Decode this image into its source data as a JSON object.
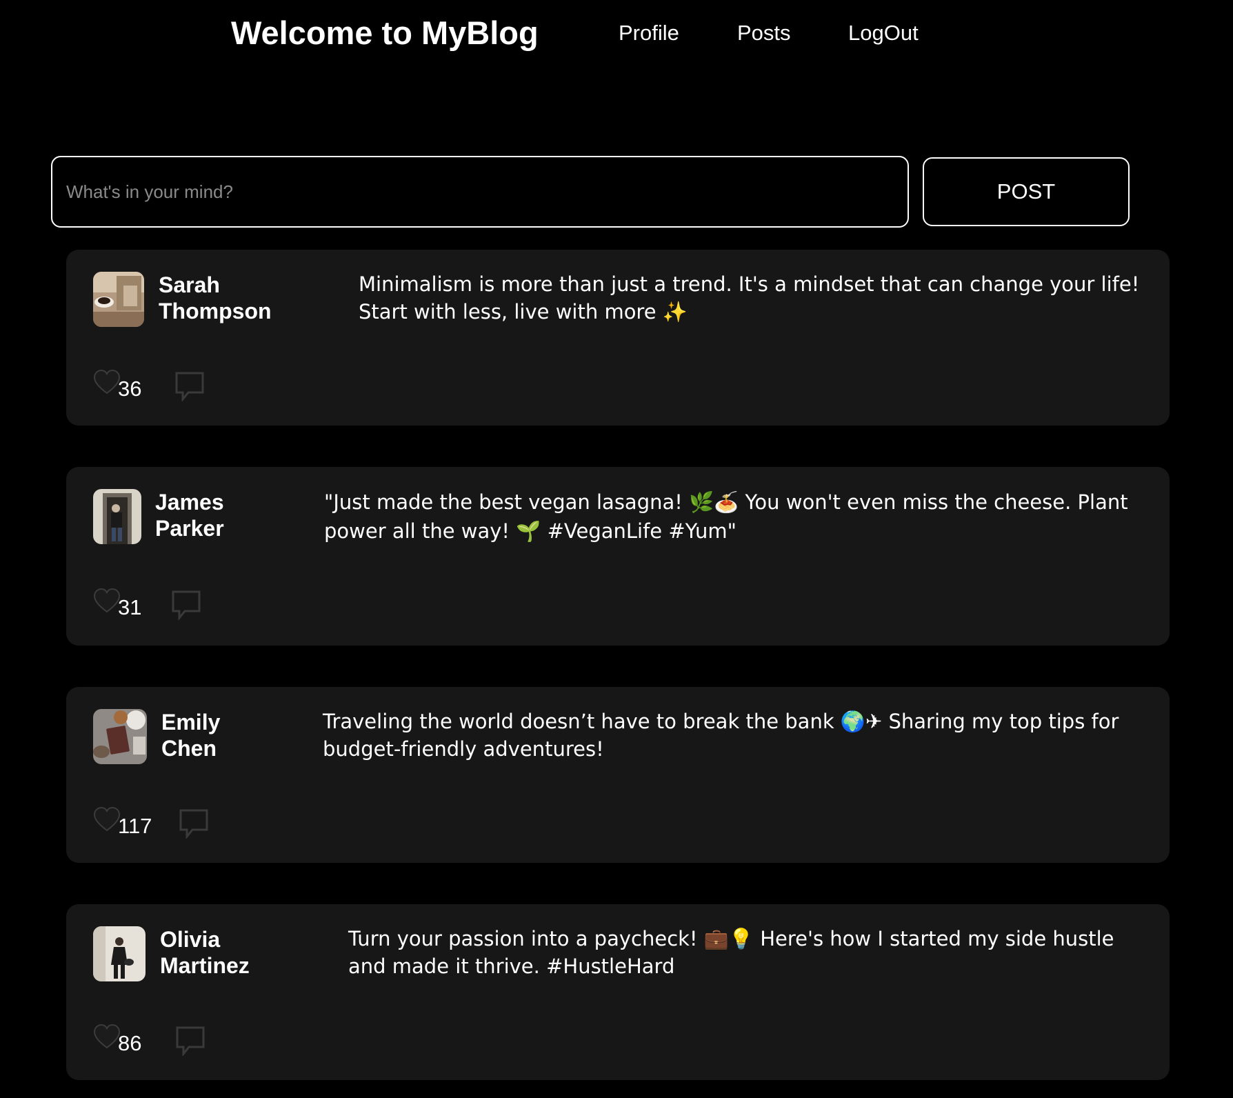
{
  "header": {
    "title": "Welcome to MyBlog",
    "nav": [
      {
        "label": "Profile"
      },
      {
        "label": "Posts"
      },
      {
        "label": "LogOut"
      }
    ]
  },
  "composer": {
    "placeholder": "What's in your mind?",
    "value": "",
    "post_label": "POST"
  },
  "colors": {
    "page_background": "#000000",
    "card_background": "#171717",
    "text": "#ffffff",
    "placeholder": "#8a8a8a",
    "icon_muted": "#3a3a3a"
  },
  "posts": [
    {
      "author_first": "Sarah",
      "author_last": "Thompson",
      "text": "Minimalism is more than just a trend. It's a mindset that can change your life! Start with less, live with more ✨",
      "likes": "36",
      "avatar_icon": "avatar-coffee-book-photo"
    },
    {
      "author_first": "James",
      "author_last": "Parker",
      "text": "\"Just made the best vegan lasagna! 🌿🍝 You won't even miss the cheese. Plant power all the way! 🌱 #VeganLife #Yum\"",
      "likes": "31",
      "avatar_icon": "avatar-person-doorway-photo"
    },
    {
      "author_first": "Emily",
      "author_last": "Chen",
      "text": "Traveling the world doesn’t have to break the bank 🌍✈ Sharing my top tips for budget-friendly adventures!",
      "likes": "117",
      "avatar_icon": "avatar-passport-flatlay-photo"
    },
    {
      "author_first": "Olivia",
      "author_last": "Martinez",
      "text": "Turn your passion into a paycheck! 💼💡 Here's how I started my side hustle and made it thrive. #HustleHard",
      "likes": "86",
      "avatar_icon": "avatar-person-walking-photo"
    }
  ]
}
